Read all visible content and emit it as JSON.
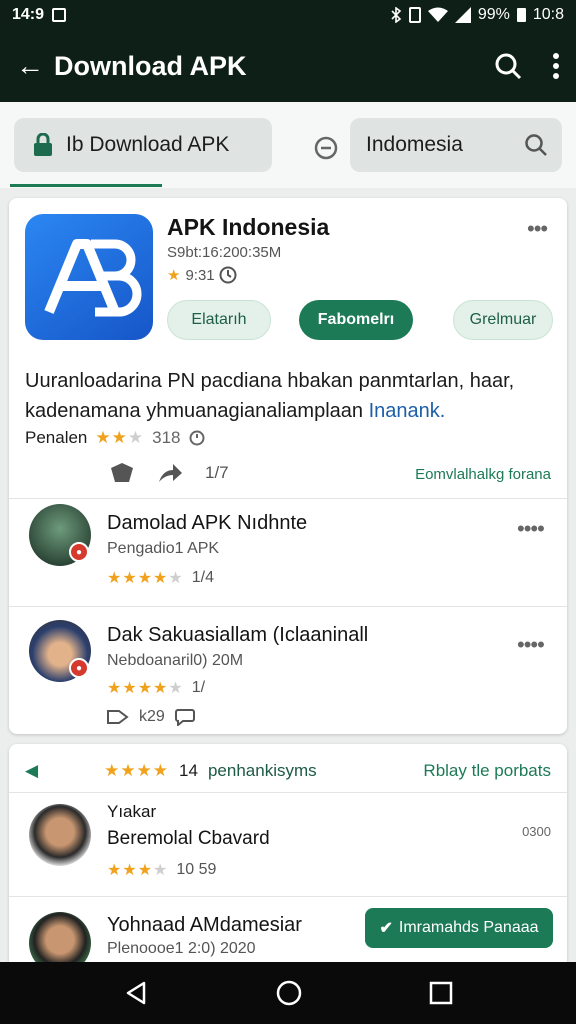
{
  "status_bar": {
    "time": "14:9",
    "battery": "99%",
    "clock_right": "10:8"
  },
  "app_bar": {
    "title": "Download APK"
  },
  "search_row": {
    "tab_label": "Ib Download APK",
    "country": "Indomesia"
  },
  "featured": {
    "title": "APK Indonesia",
    "subtitle": "S9bt:16:200:35M",
    "rating_text": "9:31",
    "rating": 1,
    "buttons": {
      "left": "Elatarıh",
      "primary": "Fabomelrı",
      "right": "Grelmuar"
    },
    "description_1": "Uuranloadarina PN pacdiana hbakan panmtarlan, haar,",
    "description_2": "kadenamana yhmuanagianaliamplaan",
    "description_link": "Inanank.",
    "meta_label": "Penalen",
    "meta_rating": 2.5,
    "meta_count": "318",
    "action_count": "1/7",
    "action_link": "Eomvlalhalkg forana"
  },
  "list1": [
    {
      "title": "Damolad APK Nıdhnte",
      "subtitle": "Pengadio1 APK",
      "rating": 4,
      "count": "1/4"
    },
    {
      "title": "Dak Sakuasiallam (Iclaaninall",
      "subtitle": "Nebdoanaril0) 20M",
      "rating": 4,
      "count": "1/",
      "footer_count": "k29"
    }
  ],
  "card2_header": {
    "rating": 4,
    "count": "14",
    "label": "penhankisyms",
    "link": "Rblay tle porbats"
  },
  "list2": [
    {
      "title": "Yıakar",
      "subtitle": "Beremolal Cbavard",
      "rating": 3,
      "count": "10 59",
      "side": "0300"
    },
    {
      "title": "Yohnaad AMdamesiar",
      "subtitle": "Plenoooe1 2:0) 2020",
      "install": "Imramahds Panaaa"
    }
  ],
  "colors": {
    "brand_dark": "#0d1f17",
    "accent_green": "#1d7a57",
    "star": "#f0a21d"
  }
}
